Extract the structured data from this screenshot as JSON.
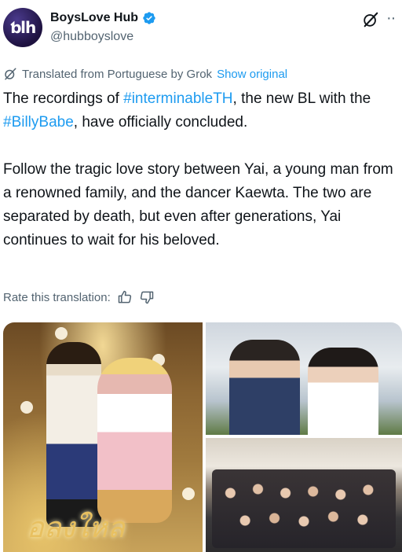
{
  "author": {
    "display_name": "BoysLove Hub",
    "handle": "@hubboyslove",
    "avatar_text": "ƅlh",
    "verified_color": "#1d9bf0"
  },
  "header_icons": [
    "grok-icon",
    "more-icon"
  ],
  "more_glyph": "··",
  "translation": {
    "label": "Translated from Portuguese by Grok",
    "show_original": "Show original"
  },
  "tweet": {
    "line1_pre": "The recordings of ",
    "hashtag1": "#interminableTH",
    "line1_post": ", the new BL with the ",
    "hashtag2": "#BillyBabe",
    "line1_end": ", have officially concluded.",
    "paragraph2": "Follow the tragic love story between Yai, a young man from a renowned family, and the dancer Kaewta. The two are separated by death, but even after generations, Yai continues to wait for his beloved."
  },
  "rate": {
    "label": "Rate this translation:"
  },
  "media": {
    "poster_logo_text": "อลงใหล"
  },
  "colors": {
    "link": "#1d9bf0",
    "muted": "#536471",
    "text": "#0f1419"
  }
}
